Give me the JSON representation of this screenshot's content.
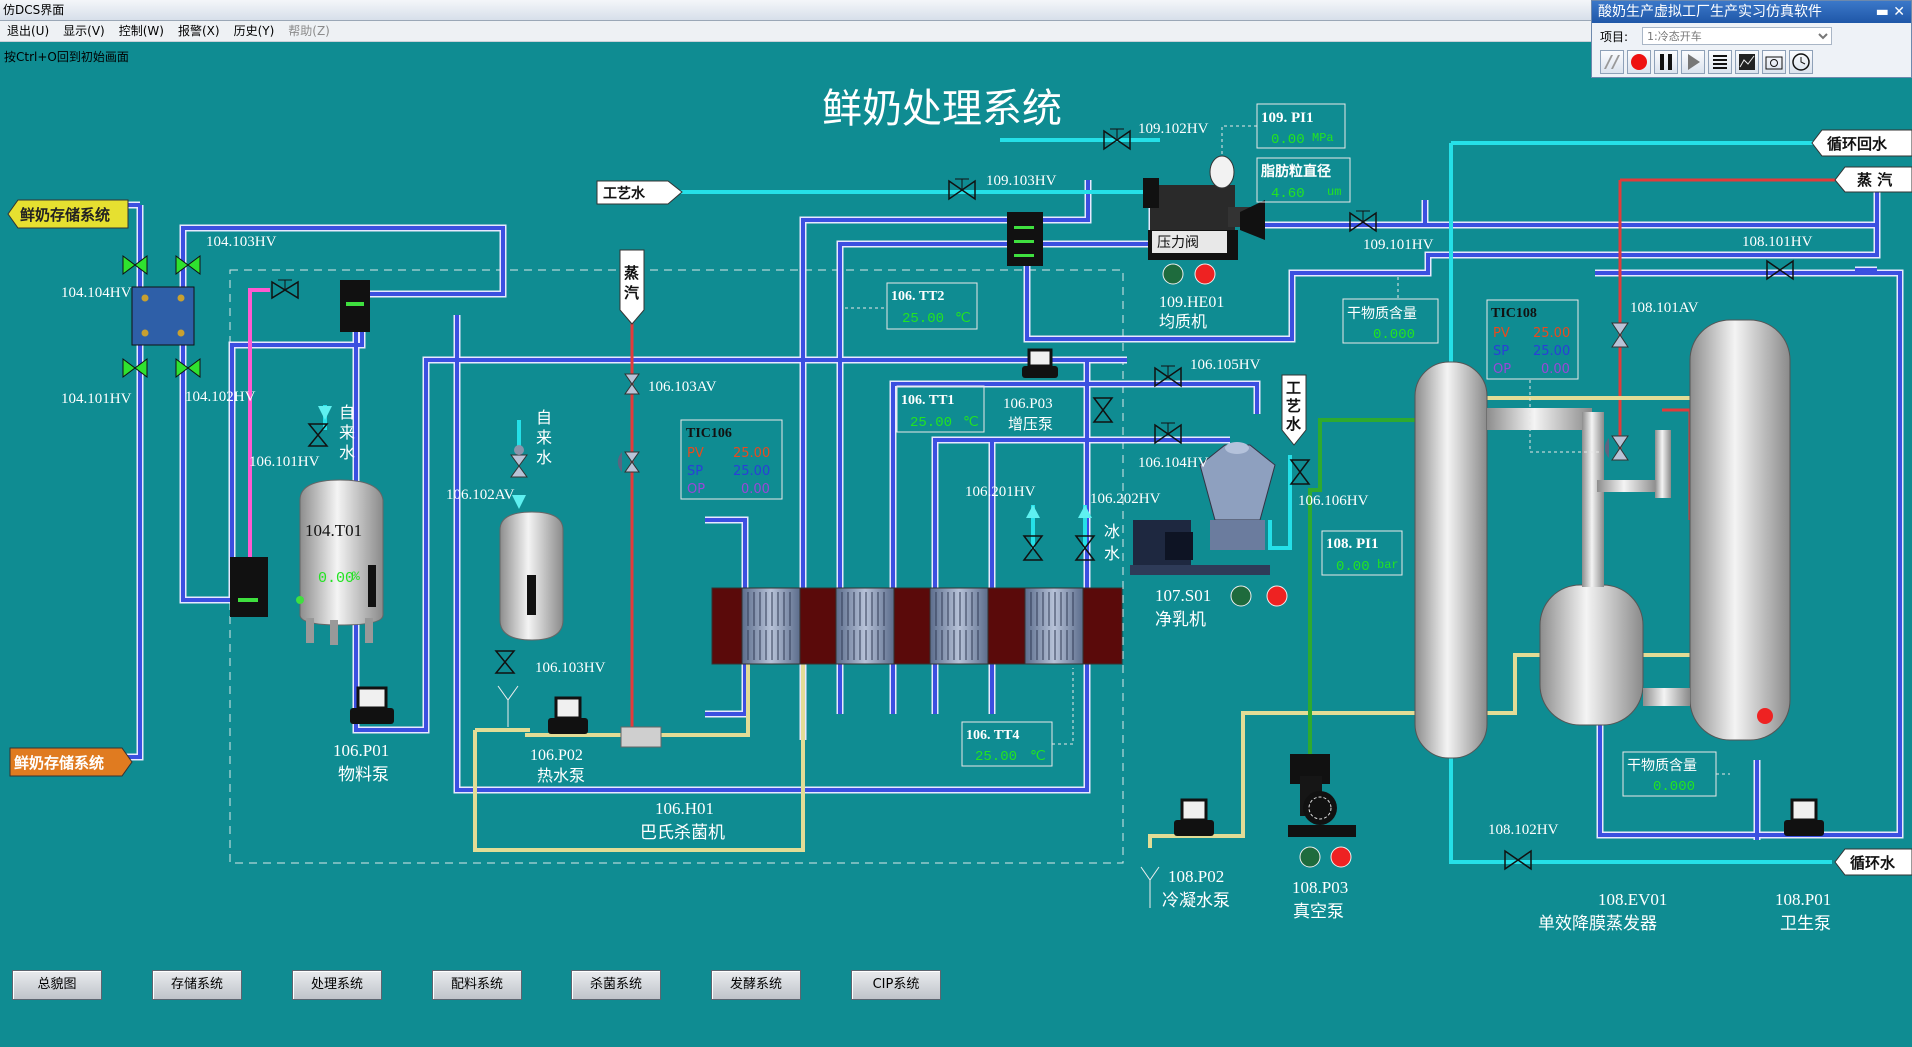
{
  "window": {
    "title": "仿DCS界面"
  },
  "menu": [
    "退出(U)",
    "显示(V)",
    "控制(W)",
    "报警(X)",
    "历史(Y)",
    "帮助(Z)"
  ],
  "hint": "按Ctrl+O回到初始画面",
  "panel": {
    "title": "酸奶生产虚拟工厂生产实习仿真软件",
    "project_label": "项目:",
    "project_value": "1:冷态开车"
  },
  "page_title": "鲜奶处理系统",
  "arrows": {
    "milk_storage_in": "鲜奶存储系统",
    "milk_storage_out": "鲜奶存储系统",
    "process_water": "工艺水",
    "steam_vertical": "蒸汽",
    "return_water": "循环回水",
    "steam_right": "蒸 汽",
    "circ_water": "循环水",
    "process_water_v": "工艺水"
  },
  "tags": {
    "v104_104": "104.104HV",
    "v104_103": "104.103HV",
    "v104_101": "104.101HV",
    "v104_102": "104.102HV",
    "v106_101": "106.101HV",
    "tap1": "自来水",
    "tank104": "104.T01",
    "tank104_level": "0.00",
    "pct": "%",
    "v106_102av": "106.102AV",
    "tap2": "自来水",
    "v106_103hv": "106.103HV",
    "v106_103av": "106.103AV",
    "v109_103": "109.103HV",
    "v109_102": "109.102HV",
    "pi109_label": "109. PI1",
    "pi109_val": "0.00",
    "pi109_unit": "MPa",
    "fat_label": "脂肪粒直径",
    "fat_val": "4.60",
    "fat_unit": "um",
    "press_valve": "压力阀",
    "he01": "109.HE01",
    "he01_name": "均质机",
    "v109_101": "109.101HV",
    "tt2_label": "106. TT2",
    "tt2_val": "25.00",
    "tt_unit": "℃",
    "tt1_label": "106. TT1",
    "tt1_val": "25.00",
    "tt4_label": "106. TT4",
    "tt4_val": "25.00",
    "tic106": "TIC106",
    "pv": "PV",
    "sp": "SP",
    "op": "OP",
    "tic106_pv": "25.00",
    "tic106_sp": "25.00",
    "tic106_op": "0.00",
    "p03_106": "106.P03",
    "p03_106_name": "增压泵",
    "v106_105": "106.105HV",
    "v106_104": "106.104HV",
    "v106_106": "106.106HV",
    "v106_201": "106.201HV",
    "v106_202": "106.202HV",
    "ice_water": "冰水",
    "s01": "107.S01",
    "s01_name": "净乳机",
    "p01_106": "106.P01",
    "p01_106_name": "物料泵",
    "p02_106": "106.P02",
    "p02_106_name": "热水泵",
    "h01": "106.H01",
    "h01_name": "巴氏杀菌机",
    "dry1_label": "干物质含量",
    "dry1_val": "0.000",
    "tic108": "TIC108",
    "tic108_pv": "25.00",
    "tic108_sp": "25.00",
    "tic108_op": "0.00",
    "v108_101hv": "108.101HV",
    "v108_101av": "108.101AV",
    "pi108_label": "108. PI1",
    "pi108_val": "0.00",
    "pi108_unit": "bar",
    "dry2_label": "干物质含量",
    "dry2_val": "0.000",
    "v108_102": "108.102HV",
    "p02_108": "108.P02",
    "p02_108_name": "冷凝水泵",
    "p03_108": "108.P03",
    "p03_108_name": "真空泵",
    "ev01": "108.EV01",
    "ev01_name": "单效降膜蒸发器",
    "p01_108": "108.P01",
    "p01_108_name": "卫生泵"
  },
  "nav_buttons": [
    "总貌图",
    "存储系统",
    "处理系统",
    "配料系统",
    "杀菌系统",
    "发酵系统",
    "CIP系统"
  ],
  "colors": {
    "background": "#0f8c92",
    "milk_pipe": "#3b4fe0",
    "water_pipe": "#25e0e8",
    "steam_pipe": "#e23b3b",
    "hot_water_pipe": "#c8c070",
    "value_green": "#22e322"
  }
}
